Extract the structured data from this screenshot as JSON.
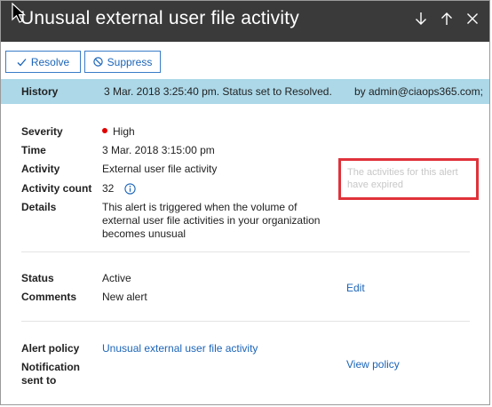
{
  "window": {
    "title": "Unusual external user file activity",
    "nav_down_icon": "arrow-down-icon",
    "nav_up_icon": "arrow-up-icon",
    "close_icon": "close-icon"
  },
  "toolbar": {
    "resolve_label": "Resolve",
    "resolve_icon": "checkmark-icon",
    "suppress_label": "Suppress",
    "suppress_icon": "prohibited-icon"
  },
  "history": {
    "label": "History",
    "entry": "3 Mar. 2018 3:25:40 pm. Status set to Resolved.",
    "by": "by admin@ciaops365.com;"
  },
  "details": {
    "severity_label": "Severity",
    "severity_value": "High",
    "severity_color": "#e00000",
    "time_label": "Time",
    "time_value": "3 Mar. 2018 3:15:00 pm",
    "activity_label": "Activity",
    "activity_value": "External user file activity",
    "count_label": "Activity count",
    "count_value": "32",
    "details_label": "Details",
    "details_value": "This alert is triggered when the volume of external user file activities in your organization becomes unusual",
    "expired_message": "The activities for this alert have expired"
  },
  "status": {
    "status_label": "Status",
    "status_value": "Active",
    "comments_label": "Comments",
    "comments_value": "New alert",
    "edit_label": "Edit"
  },
  "policy": {
    "policy_label": "Alert policy",
    "policy_value": "Unusual external user file activity",
    "notification_label_1": "Notification",
    "notification_label_2": "sent to",
    "view_policy_label": "View policy"
  },
  "colors": {
    "header_bg": "#3a3a3a",
    "accent": "#1b64b8",
    "history_bg": "#acd8e8",
    "callout_border": "#e0323a"
  }
}
